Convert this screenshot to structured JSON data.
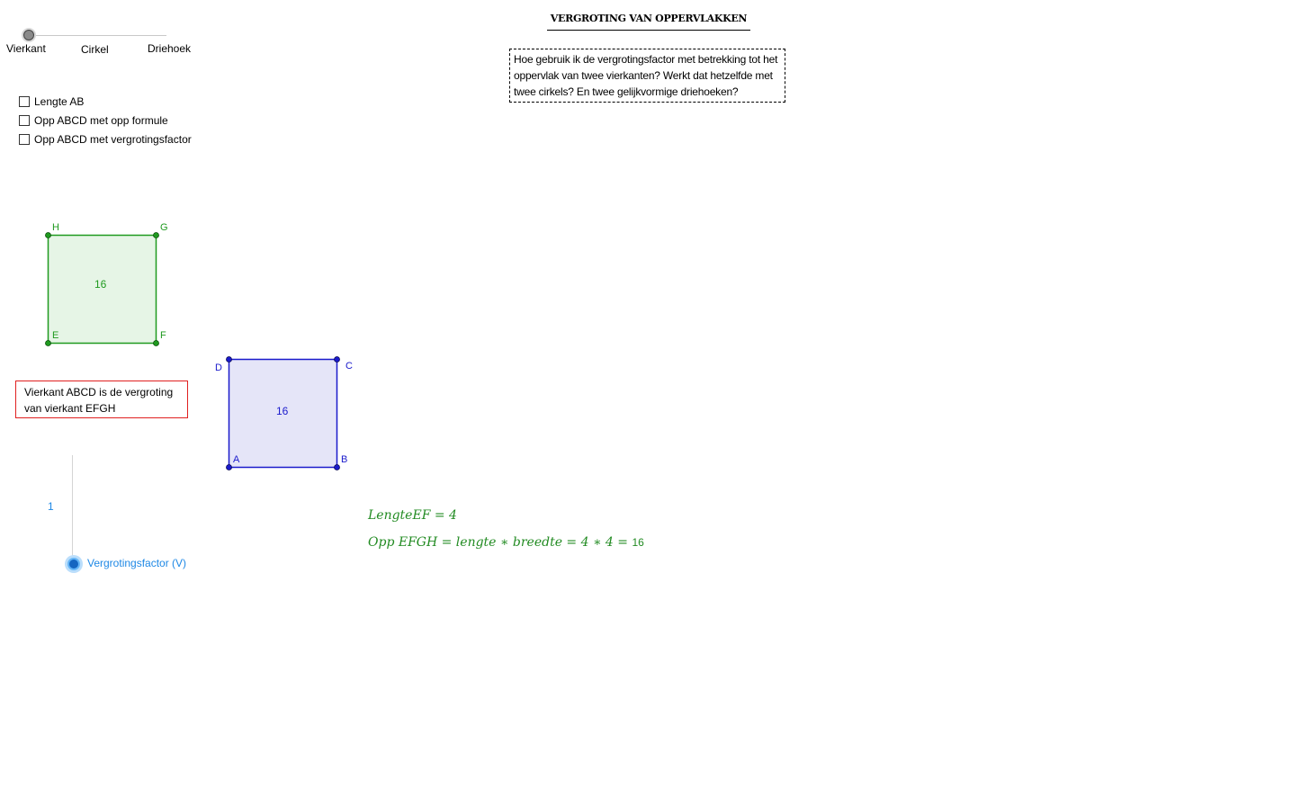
{
  "shape_slider": {
    "options": [
      "Vierkant",
      "Cirkel",
      "Driehoek"
    ],
    "selected": "Vierkant"
  },
  "title": "VERGROTING VAN OPPERVLAKKEN",
  "question": "Hoe gebruik ik de vergrotingsfactor met betrekking tot het oppervlak van twee vierkanten? Werkt dat hetzelfde met twee cirkels? En twee gelijkvormige driehoeken?",
  "checkboxes": [
    {
      "label": "Lengte AB",
      "checked": false
    },
    {
      "label": "Opp ABCD met opp formule",
      "checked": false
    },
    {
      "label": "Opp ABCD met vergrotingsfactor",
      "checked": false
    }
  ],
  "square_efgh": {
    "vertices": [
      "E",
      "F",
      "G",
      "H"
    ],
    "area_label": "16",
    "color": "#1f9a1f",
    "fill": "#e6f5e6"
  },
  "square_abcd": {
    "vertices": [
      "A",
      "B",
      "C",
      "D"
    ],
    "area_label": "16",
    "color": "#1a1acc",
    "fill": "#e5e5f8"
  },
  "info_text": "Vierkant ABCD is de vergroting van vierkant EFGH",
  "factor_slider": {
    "label": "Vergrotingsfactor (V)",
    "value": "1",
    "color": "#1e88e5"
  },
  "formulas": {
    "length_text": "LengteEF = 4",
    "area_text": "Opp  EFGH  =  lengte  ∗  breedte  =  4 ∗ 4  = ",
    "area_result": "16",
    "color": "#228b22"
  },
  "icons": {
    "slider_knob": "circle-knob",
    "checkbox": "square-checkbox"
  }
}
